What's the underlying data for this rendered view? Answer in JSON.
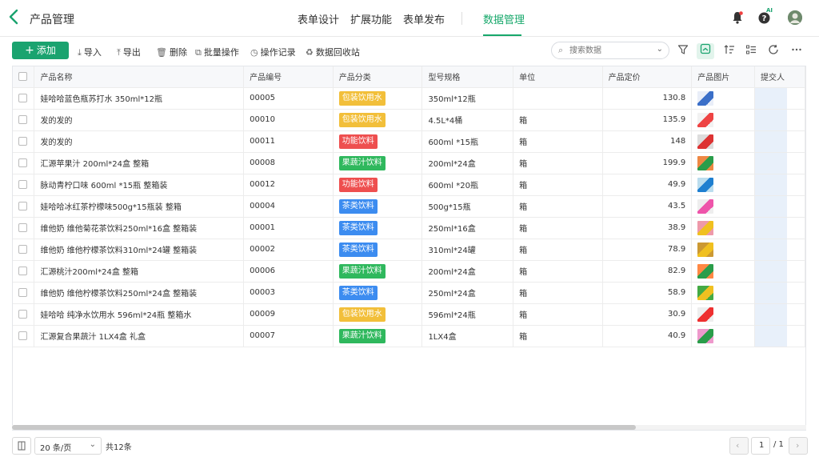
{
  "header": {
    "title": "产品管理",
    "tabs": [
      {
        "label": "表单设计"
      },
      {
        "label": "扩展功能"
      },
      {
        "label": "表单发布"
      },
      {
        "label": "数据管理"
      }
    ],
    "help_badge": "AI"
  },
  "toolbar": {
    "add_label": "添加",
    "import_label": "导入",
    "export_label": "导出",
    "delete_label": "删除",
    "batch_label": "批量操作",
    "log_label": "操作记录",
    "recycle_label": "数据回收站",
    "search_placeholder": "搜索数据"
  },
  "table": {
    "columns": [
      "产品名称",
      "产品编号",
      "产品分类",
      "型号规格",
      "单位",
      "产品定价",
      "产品图片",
      "提交人"
    ],
    "rows": [
      {
        "name": "娃哈哈蓝色瓶苏打水 350ml*12瓶",
        "code": "00005",
        "category": "包装饮用水",
        "spec": "350ml*12瓶",
        "unit": "",
        "price": "130.8"
      },
      {
        "name": "发的发的",
        "code": "00010",
        "category": "包装饮用水",
        "spec": "4.5L*4桶",
        "unit": "箱",
        "price": "135.9"
      },
      {
        "name": "发的发的",
        "code": "00011",
        "category": "功能饮料",
        "spec": "600ml *15瓶",
        "unit": "箱",
        "price": "148"
      },
      {
        "name": "汇源苹果汁 200ml*24盒 整箱",
        "code": "00008",
        "category": "果蔬汁饮料",
        "spec": "200ml*24盒",
        "unit": "箱",
        "price": "199.9"
      },
      {
        "name": "脉动青柠口味 600ml *15瓶 整箱装",
        "code": "00012",
        "category": "功能饮料",
        "spec": "600ml *20瓶",
        "unit": "箱",
        "price": "49.9"
      },
      {
        "name": "娃哈哈冰红茶柠檬味500g*15瓶装 整箱",
        "code": "00004",
        "category": "茶类饮料",
        "spec": "500g*15瓶",
        "unit": "箱",
        "price": "43.5"
      },
      {
        "name": "维他奶 维他菊花茶饮料250ml*16盒 整箱装",
        "code": "00001",
        "category": "茶类饮料",
        "spec": "250ml*16盒",
        "unit": "箱",
        "price": "38.9"
      },
      {
        "name": "维他奶 维他柠檬茶饮料310ml*24罐 整箱装",
        "code": "00002",
        "category": "茶类饮料",
        "spec": "310ml*24罐",
        "unit": "箱",
        "price": "78.9"
      },
      {
        "name": "汇源桃汁200ml*24盒 整箱",
        "code": "00006",
        "category": "果蔬汁饮料",
        "spec": "200ml*24盒",
        "unit": "箱",
        "price": "82.9"
      },
      {
        "name": "维他奶 维他柠檬茶饮料250ml*24盒 整箱装",
        "code": "00003",
        "category": "茶类饮料",
        "spec": "250ml*24盒",
        "unit": "箱",
        "price": "58.9"
      },
      {
        "name": "娃哈哈 纯净水饮用水 596ml*24瓶 整箱水",
        "code": "00009",
        "category": "包装饮用水",
        "spec": "596ml*24瓶",
        "unit": "箱",
        "price": "30.9"
      },
      {
        "name": "汇源复合果蔬汁 1LX4盒 礼盒",
        "code": "00007",
        "category": "果蔬汁饮料",
        "spec": "1LX4盒",
        "unit": "箱",
        "price": "40.9"
      }
    ]
  },
  "category_colors": {
    "包装饮用水": "#f2bf3a",
    "功能饮料": "#ee4f4f",
    "果蔬汁饮料": "#2fb85d",
    "茶类饮料": "#3c8cf0"
  },
  "footer": {
    "page_size": "20 条/页",
    "total": "共12条",
    "current_page": "1",
    "total_pages": "/ 1"
  }
}
